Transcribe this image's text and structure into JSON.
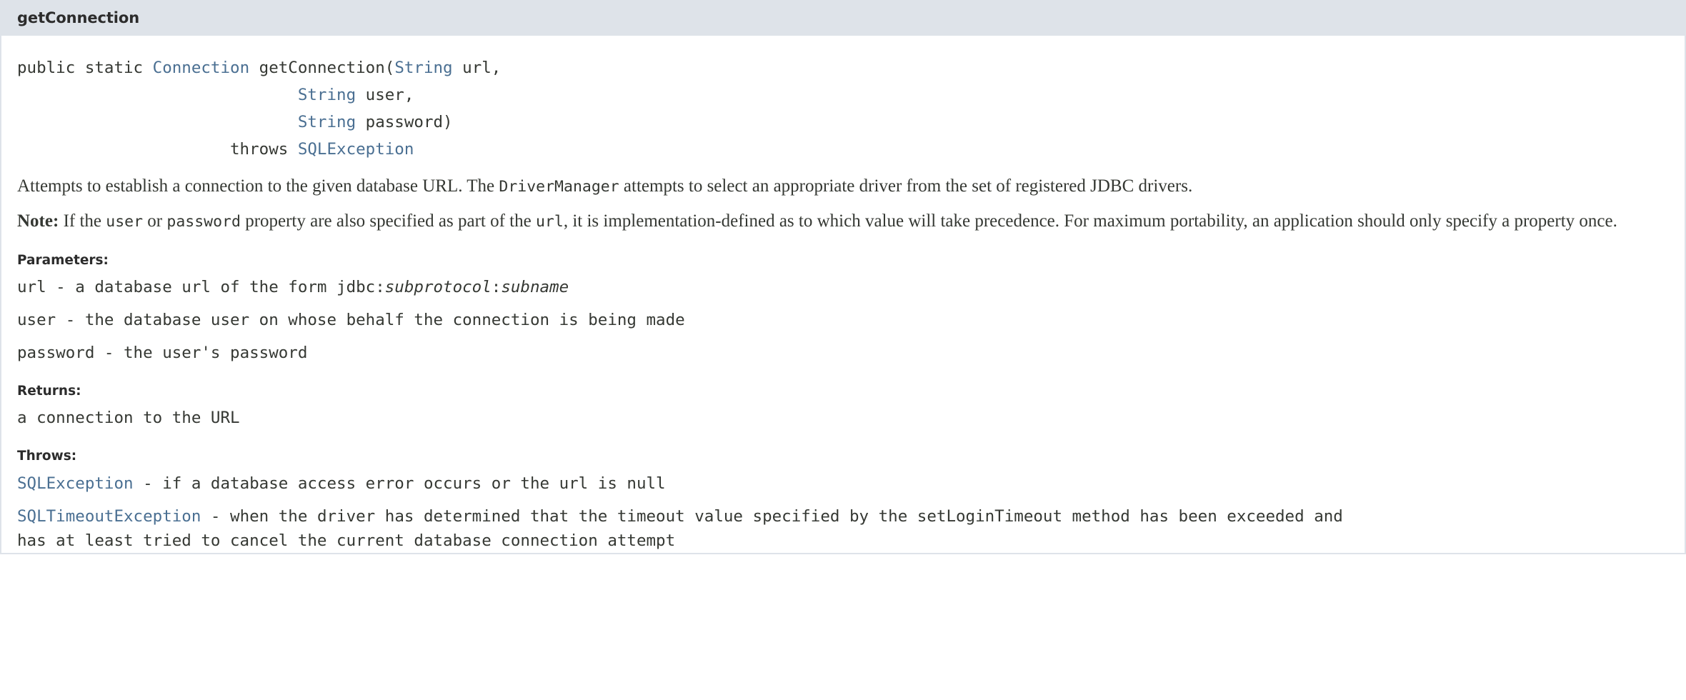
{
  "member": {
    "anchor_title": "getConnection",
    "signature": {
      "modifiers": "public static ",
      "return_type": "Connection",
      "name": " getConnection(",
      "param1_type": "String",
      "param1_name": " url,",
      "param2_indent": "                             ",
      "param2_type": "String",
      "param2_name": " user,",
      "param3_indent": "                             ",
      "param3_type": "String",
      "param3_name": " password)",
      "throws_indent": "                      ",
      "throws_keyword": "throws ",
      "throws_type": "SQLException"
    },
    "description": {
      "part1": "Attempts to establish a connection to the given database URL. The ",
      "code1": "DriverManager",
      "part2": " attempts to select an appropriate driver from the set of registered JDBC drivers."
    },
    "note": {
      "label": "Note:",
      "part1": " If the ",
      "code1": "user",
      "part2": " or ",
      "code2": "password",
      "part3": " property are also specified as part of the ",
      "code3": "url",
      "part4": ", it is implementation-defined as to which value will take precedence. For maximum portability, an application should only specify a property once."
    },
    "parameters": {
      "label": "Parameters:",
      "items": [
        {
          "name": "url",
          "sep": " - ",
          "desc_part1": "a database url of the form jdbc:",
          "desc_italic1": "subprotocol",
          "desc_part2": ":",
          "desc_italic2": "subname",
          "desc_part3": ""
        },
        {
          "name": "user",
          "sep": " - ",
          "desc_part1": "the database user on whose behalf the connection is being made",
          "desc_italic1": "",
          "desc_part2": "",
          "desc_italic2": "",
          "desc_part3": ""
        },
        {
          "name": "password",
          "sep": " - ",
          "desc_part1": "the user's password",
          "desc_italic1": "",
          "desc_part2": "",
          "desc_italic2": "",
          "desc_part3": ""
        }
      ]
    },
    "returns": {
      "label": "Returns:",
      "text": "a connection to the URL"
    },
    "throws": {
      "label": "Throws:",
      "items": [
        {
          "type": "SQLException",
          "sep": " - ",
          "desc": "if a database access error occurs or the url is null",
          "desc_line2": ""
        },
        {
          "type": "SQLTimeoutException",
          "sep": " - ",
          "desc": "when the driver has determined that the timeout value specified by the setLoginTimeout method has been exceeded and",
          "desc_line2": "has at least tried to cancel the current database connection attempt"
        }
      ]
    }
  },
  "colors": {
    "header_bg": "#dee3e9",
    "link": "#4a6f92",
    "text": "#353833",
    "page_bg": "#ffffff"
  }
}
